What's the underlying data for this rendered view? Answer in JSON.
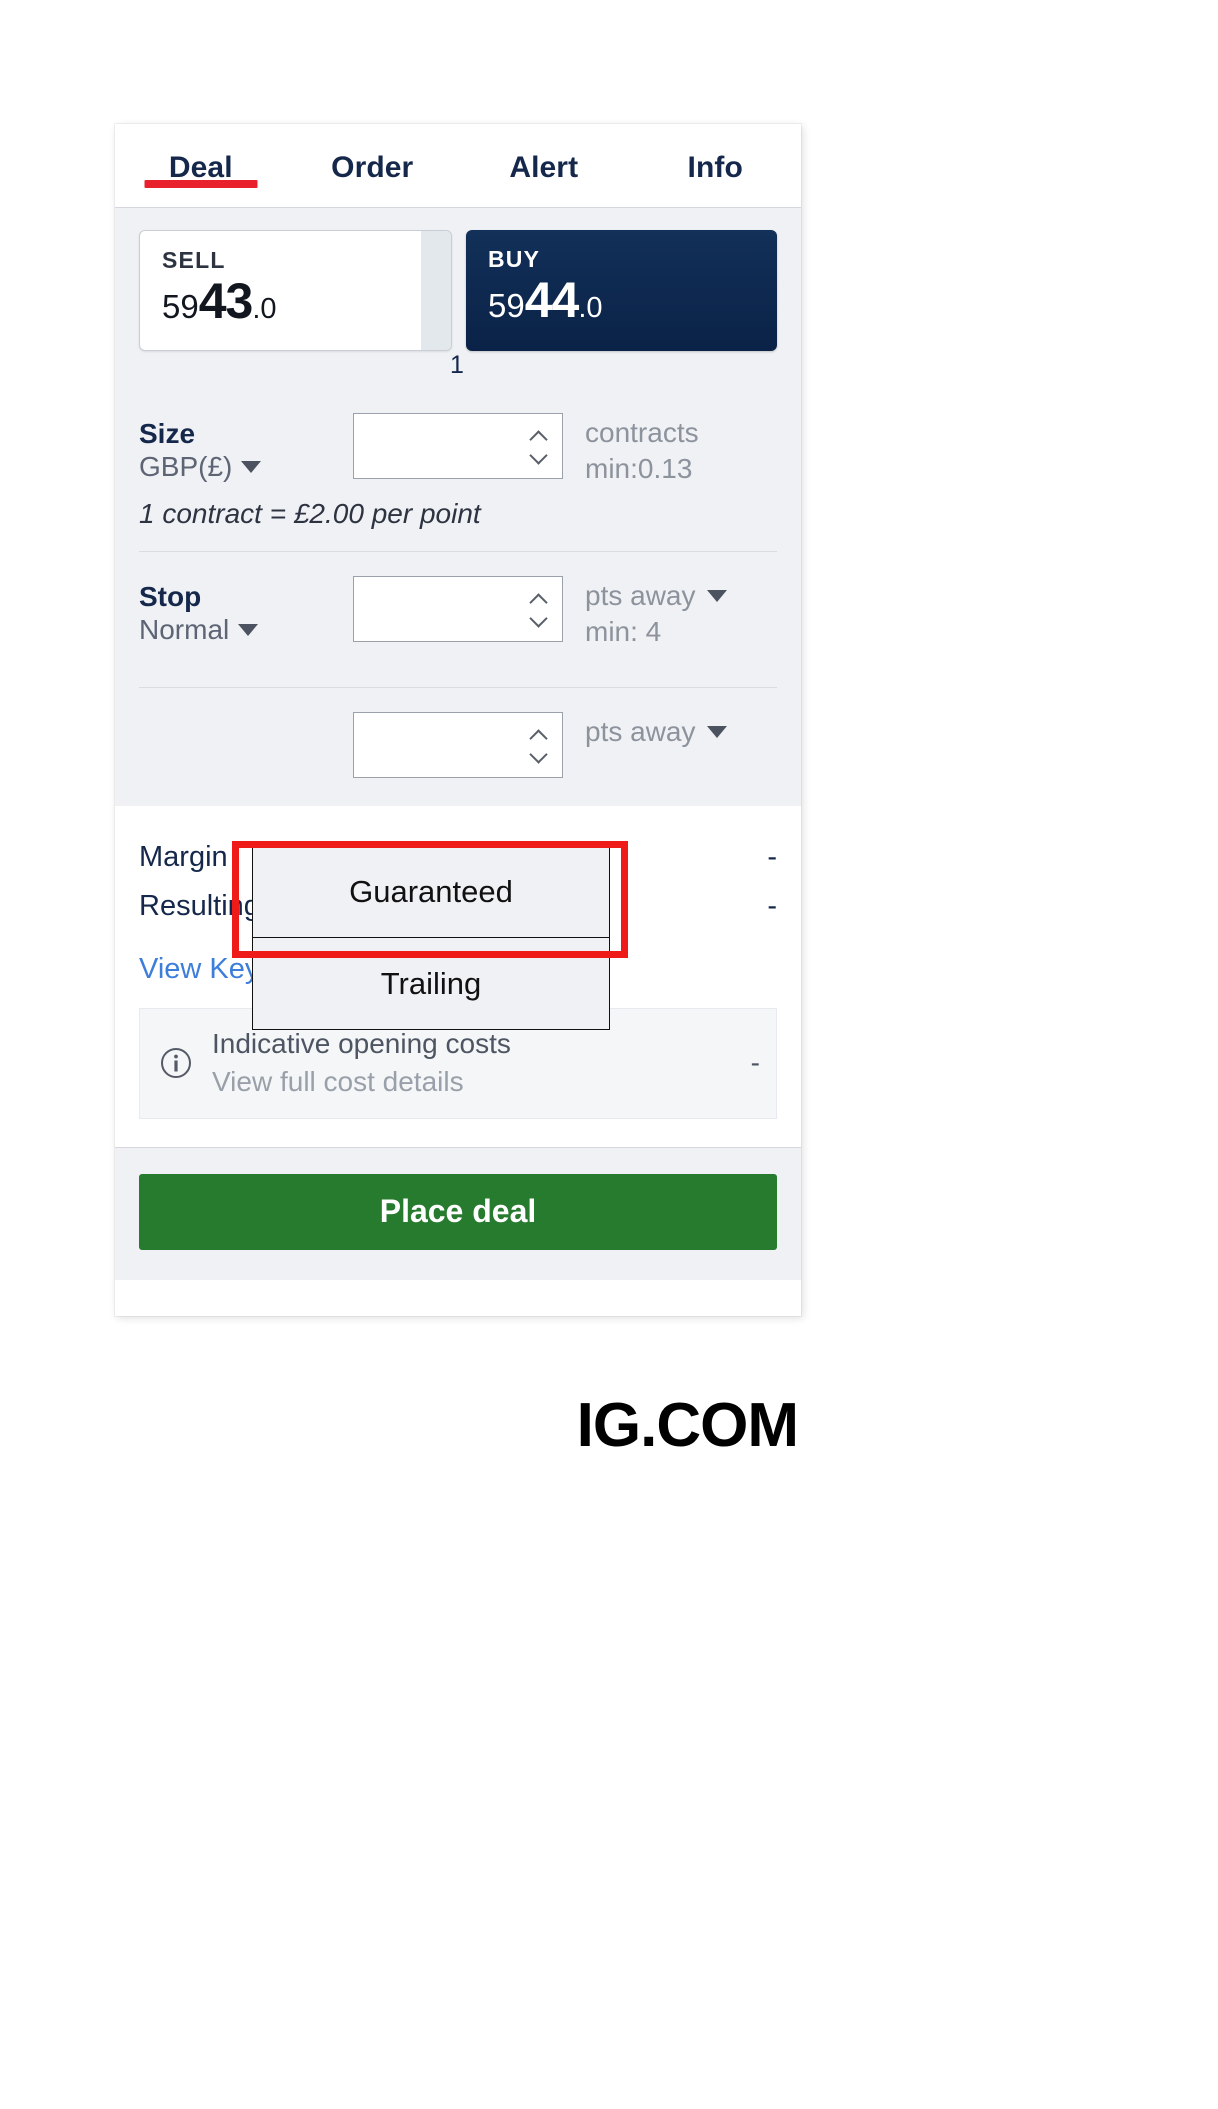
{
  "tabs": [
    {
      "label": "Deal",
      "active": true
    },
    {
      "label": "Order",
      "active": false
    },
    {
      "label": "Alert",
      "active": false
    },
    {
      "label": "Info",
      "active": false
    }
  ],
  "prices": {
    "sell": {
      "label": "SELL",
      "lead": "59",
      "big": "43",
      "dec": ".0",
      "full": "5943.0"
    },
    "buy": {
      "label": "BUY",
      "lead": "59",
      "big": "44",
      "dec": ".0",
      "full": "5944.0"
    },
    "spread": "1"
  },
  "size": {
    "label": "Size",
    "currency": "GBP(£)",
    "value": "",
    "unit": "contracts",
    "min": "min:0.13",
    "note": "1 contract = £2.00 per point"
  },
  "stop": {
    "label": "Stop",
    "type": "Normal",
    "value": "",
    "unit": "pts away",
    "min": "min: 4",
    "options": [
      "Guaranteed",
      "Trailing"
    ]
  },
  "limit": {
    "value": "",
    "unit": "pts away"
  },
  "summary": {
    "margin_label": "Margin",
    "margin_value": "-",
    "position_label": "Resulting position",
    "position_value": "-",
    "kid_link": "View Key Information Document",
    "kid_icon": "external-link-icon",
    "costs_icon": "info-icon",
    "costs_title": "Indicative opening costs",
    "costs_sub": "View full cost details",
    "costs_value": "-"
  },
  "footer": {
    "place_deal": "Place deal"
  },
  "brand": {
    "text": "IG.COM"
  },
  "colors": {
    "accent_red": "#e8212d",
    "buy_navy": "#0f2b54",
    "place_green": "#277b2f",
    "link_blue": "#3d7edb",
    "highlight_red": "#ee1b19"
  }
}
